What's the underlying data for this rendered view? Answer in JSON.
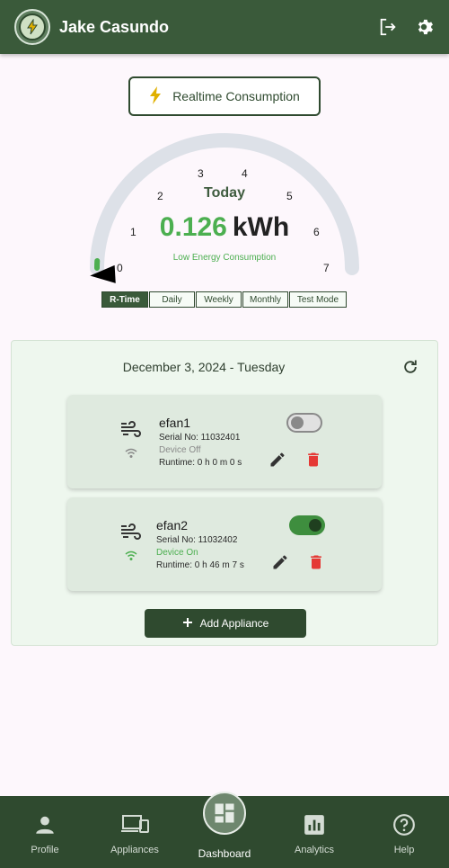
{
  "header": {
    "username": "Jake Casundo",
    "logout_icon": "logout-icon",
    "settings_icon": "gear-icon"
  },
  "realtime_button": {
    "label": "Realtime Consumption",
    "icon": "bolt-icon"
  },
  "gauge": {
    "period": "Today",
    "value": "0.126",
    "unit": "kWh",
    "status": "Low Energy Consumption",
    "scale_labels": [
      "0",
      "1",
      "2",
      "3",
      "4",
      "5",
      "6",
      "7"
    ],
    "scale_min": 0,
    "scale_max": 7,
    "current_value": 0.126,
    "colors": {
      "track": "#dde1e8",
      "fill": "#4caf50",
      "needle": "#000000"
    }
  },
  "mode_tabs": [
    {
      "label": "R-Time",
      "active": true
    },
    {
      "label": "Daily",
      "active": false
    },
    {
      "label": "Weekly",
      "active": false
    },
    {
      "label": "Monthly",
      "active": false
    },
    {
      "label": "Test Mode",
      "active": false
    }
  ],
  "panel": {
    "date": "December 3, 2024 - Tuesday",
    "refresh_icon": "refresh-icon",
    "appliances": [
      {
        "name": "efan1",
        "serial": "Serial No: 11032401",
        "status": "Device Off",
        "runtime": "Runtime: 0 h 0 m 0 s",
        "on": false,
        "status_color": "#8a8a8a",
        "wifi_color": "#8a8a8a"
      },
      {
        "name": "efan2",
        "serial": "Serial No: 11032402",
        "status": "Device On",
        "runtime": "Runtime: 0 h 46 m 7 s",
        "on": true,
        "status_color": "#4caf50",
        "wifi_color": "#4caf50"
      }
    ],
    "add_button": "Add Appliance"
  },
  "bottom_nav": [
    {
      "label": "Profile",
      "icon": "person-icon",
      "active": false
    },
    {
      "label": "Appliances",
      "icon": "devices-icon",
      "active": false
    },
    {
      "label": "Dashboard",
      "icon": "dashboard-icon",
      "active": true
    },
    {
      "label": "Analytics",
      "icon": "analytics-icon",
      "active": false
    },
    {
      "label": "Help",
      "icon": "help-icon",
      "active": false
    }
  ],
  "colors": {
    "primary": "#3a5a3a",
    "accent_green": "#4caf50",
    "delete_red": "#e53935",
    "bolt_yellow": "#e0b000"
  }
}
